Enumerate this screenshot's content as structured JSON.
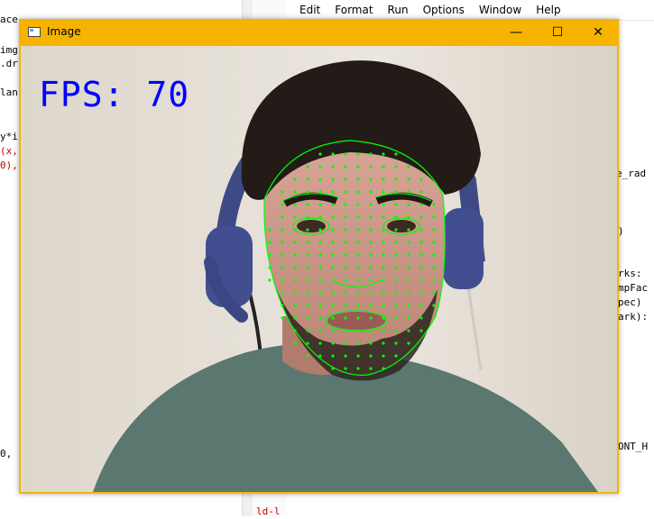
{
  "left_editor": {
    "lines": [
      {
        "text": "ace",
        "color": "black"
      },
      {
        "text": "img",
        "color": "black"
      },
      {
        "text": ".dr",
        "color": "black"
      },
      {
        "text": "lan",
        "color": "black"
      },
      {
        "text": "y*i",
        "color": "black"
      },
      {
        "text": "(x,",
        "color": "red"
      },
      {
        "text": "0),",
        "color": "red"
      },
      {
        "text": "0,",
        "color": "black"
      }
    ]
  },
  "right_editor": {
    "menu": [
      "Edit",
      "Format",
      "Run",
      "Options",
      "Window",
      "Help"
    ],
    "lines": [
      "e_rad",
      ")",
      "rks:",
      "mpFac",
      "pec)",
      "ark):",
      "ONT_H"
    ],
    "bottom_snippet": "ld-l"
  },
  "window": {
    "title": "Image",
    "min_glyph": "—",
    "max_glyph": "☐",
    "close_glyph": "✕",
    "fps_text": "FPS: 70"
  },
  "colors": {
    "title_bar": "#f6b400",
    "fps": "#0000ff",
    "mesh": "#00ff00"
  }
}
